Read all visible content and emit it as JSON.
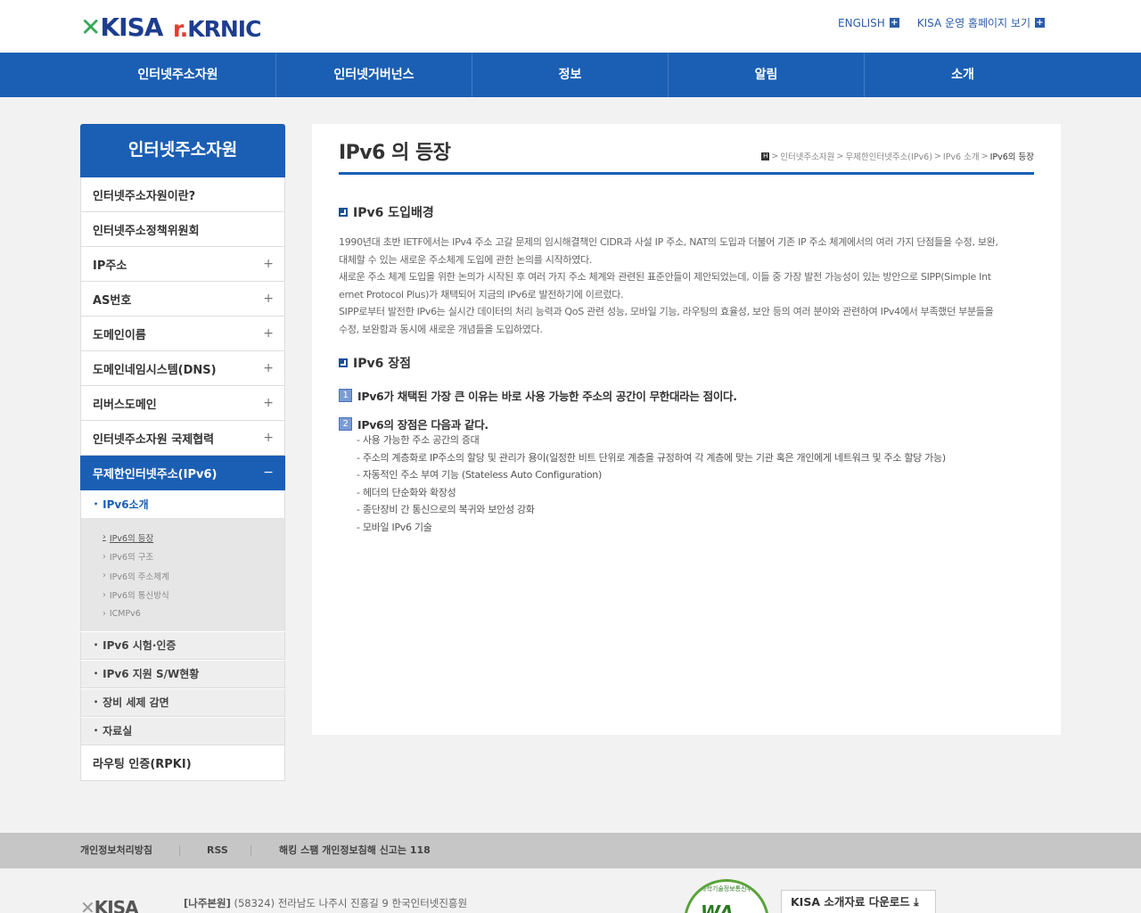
{
  "header": {
    "logo_kisa": "KISA",
    "logo_krnic": "KRNIC",
    "links": [
      "ENGLISH",
      "KISA 운영 홈페이지 보기"
    ]
  },
  "gnb": [
    "인터넷주소자원",
    "인터넷거버넌스",
    "정보",
    "알림",
    "소개"
  ],
  "lnb": {
    "title": "인터넷주소자원",
    "items": [
      {
        "label": "인터넷주소자원이란?",
        "plus": ""
      },
      {
        "label": "인터넷주소정책위원회",
        "plus": ""
      },
      {
        "label": "IP주소",
        "plus": "+"
      },
      {
        "label": "AS번호",
        "plus": "+"
      },
      {
        "label": "도메인이름",
        "plus": "+"
      },
      {
        "label": "도메인네임시스템(DNS)",
        "plus": "+"
      },
      {
        "label": "리버스도메인",
        "plus": "+"
      },
      {
        "label": "인터넷주소자원 국제협력",
        "plus": "+"
      }
    ],
    "active": {
      "label": "무제한인터넷주소(IPv6)",
      "minus": "−"
    },
    "sub_current": "IPv6소개",
    "sub3": [
      "IPv6의 등장",
      "IPv6의 구조",
      "IPv6의 주소체계",
      "IPv6의 통신방식",
      "ICMPv6"
    ],
    "sub_others": [
      "IPv6 시험·인증",
      "IPv6 지원 S/W현황",
      "장비 세제 감면",
      "자료실"
    ],
    "last": "라우팅 인증(RPKI)"
  },
  "content": {
    "title": "IPv6 의 등장",
    "breadcrumb": [
      "인터넷주소자원",
      "무제한인터넷주소(IPv6)",
      "IPv6 소개",
      "IPv6의 등장"
    ],
    "section1_title": "IPv6 도입배경",
    "section1_lines": [
      "1990년대 초반 IETF에서는 IPv4 주소 고갈 문제의 임시해결책인 CIDR과 사설 IP 주소, NAT의 도입과 더불어 기존 IP 주소 체계에서의 여러 가지 단점들을 수정, 보완,",
      "대체할 수 있는 새로운 주소체계 도입에 관한 논의를 시작하였다.",
      "새로운 주소 체계 도입을 위한 논의가 시작된 후 여러 가지 주소 체계와 관련된 표준안들이 제안되었는데, 이들 중 가장 발전 가능성이 있는 방안으로 SIPP(Simple Int",
      "ernet Protocol Plus)가 채택되어 지금의 IPv6로 발전하기에 이르렀다.",
      "SIPP로부터 발전한 IPv6는 실시간 데이터의 처리 능력과 QoS 관련 성능, 모바일 기능, 라우팅의 효율성, 보안 등의 여러 분야와 관련하여 IPv4에서 부족했던 부분들을",
      "수정, 보완함과 동시에 새로운 개념들을 도입하였다."
    ],
    "section2_title": "IPv6 장점",
    "point1_num": "1",
    "point1": "IPv6가 채택된 가장 큰 이유는 바로 사용 가능한 주소의 공간이 무한대라는 점이다.",
    "point2_num": "2",
    "point2": "IPv6의 장점은 다음과 같다.",
    "advantages": [
      "- 사용 가능한 주소 공간의 증대",
      "- 주소의 계층화로 IP주소의 할당 및 관리가 용이(일정한 비트 단위로 계층을 규정하여 각 계층에 맞는 기관 혹은 개인에게 네트워크 및 주소 할당 가능)",
      "- 자동적인 주소 부여 기능 (Stateless Auto Configuration)",
      "- 헤더의 단순화와 확장성",
      "- 종단장비 간 통신으로의 복귀와 보안성 강화",
      "- 모바일 IPv6 기술"
    ]
  },
  "footer": {
    "links": [
      "개인정보처리방침",
      "RSS",
      "해킹 스팸 개인정보침해 신고는 118"
    ],
    "logo": "KISA",
    "addr_label": "[나주본원]",
    "addr": "(58324) 전라남도 나주시 진흥길 9 한국인터넷진흥원",
    "wa_mark": "WA",
    "wa_caption": "과학기술정보통신부",
    "download_btn": "KISA 소개자료 다운로드 ⤓"
  }
}
